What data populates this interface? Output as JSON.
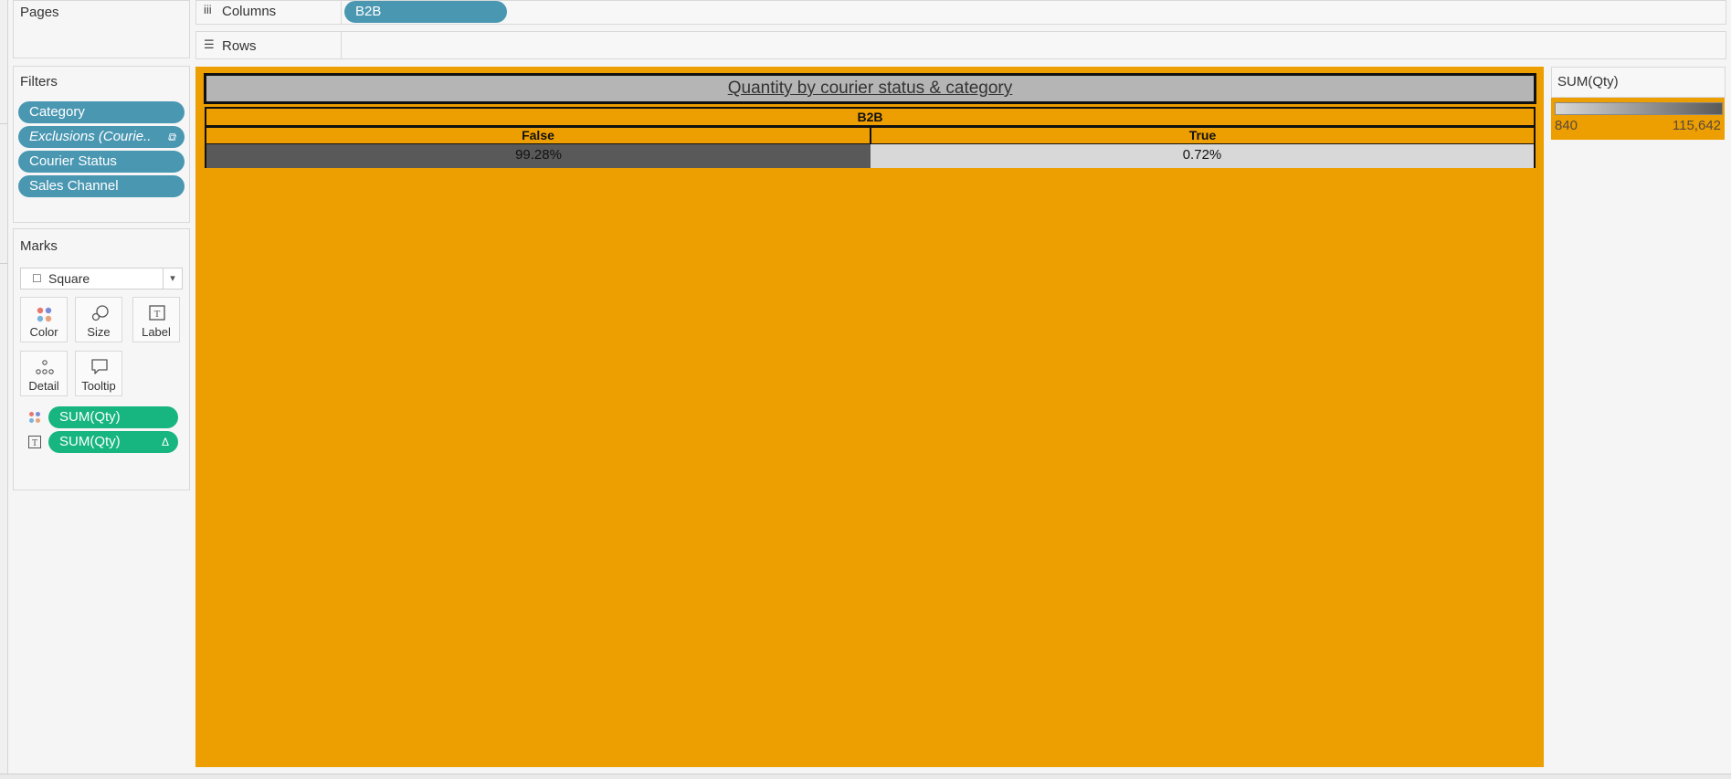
{
  "pages": {
    "title": "Pages"
  },
  "shelves": {
    "columns_label": "Columns",
    "columns_icon": "iii",
    "columns_pill": "B2B",
    "rows_label": "Rows",
    "rows_icon": "☰"
  },
  "filters": {
    "title": "Filters",
    "items": [
      {
        "label": "Category"
      },
      {
        "label": "Exclusions (Courie..",
        "badge": "⧉"
      },
      {
        "label": "Courier Status"
      },
      {
        "label": "Sales Channel"
      }
    ]
  },
  "marks": {
    "title": "Marks",
    "type_label": "Square",
    "type_icon": "☐",
    "dropdown_arrow": "▾",
    "buttons": [
      {
        "label": "Color",
        "icon": "color-icon"
      },
      {
        "label": "Size",
        "icon": "size-icon"
      },
      {
        "label": "Label",
        "icon": "label-icon"
      },
      {
        "label": "Detail",
        "icon": "detail-icon"
      },
      {
        "label": "Tooltip",
        "icon": "tooltip-icon"
      }
    ],
    "fields": [
      {
        "label": "SUM(Qty)",
        "icon": "color-icon"
      },
      {
        "label": "SUM(Qty)",
        "icon": "label-icon",
        "badge": "Δ"
      }
    ]
  },
  "viz": {
    "title": "Quantity by courier status & category",
    "column_header": "B2B",
    "subheaders": [
      "False",
      "True"
    ],
    "cells": [
      "99.28%",
      "0.72%"
    ],
    "colors": {
      "background": "#ed9e00",
      "false_cell": "#595959",
      "true_cell": "#d8d8d8"
    }
  },
  "legend": {
    "title": "SUM(Qty)",
    "min_label": "840",
    "max_label": "115,642",
    "colors": {
      "low": "#d8d8d8",
      "high": "#595959"
    }
  }
}
